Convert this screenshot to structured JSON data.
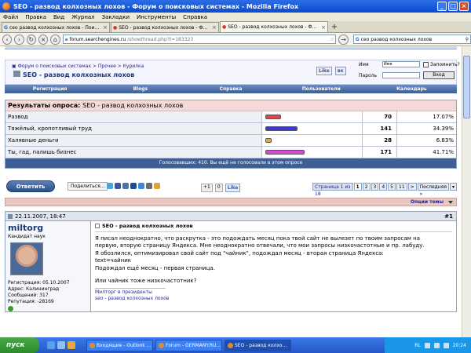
{
  "window": {
    "title": "SEO - развод колхозных лохов - Форум о поисковых системах - Mozilla Firefox"
  },
  "menu": [
    "Файл",
    "Правка",
    "Вид",
    "Журнал",
    "Закладки",
    "Инструменты",
    "Справка"
  ],
  "tabs": [
    {
      "label": "сео развод колхозных лохов - Поиск в..."
    },
    {
      "label": "SEO - развод колхозных лохов - Фору..."
    },
    {
      "label": "SEO - развод колхозных лохов - Фору..."
    }
  ],
  "address": {
    "domain": "forum.searchengines.ru",
    "path": "/showthread.php?t=183323"
  },
  "search": {
    "value": "сео развод колхозных лохов"
  },
  "forum": {
    "breadcrumb": [
      "Форум о поисковых системах",
      "Прочее",
      "Курилка"
    ],
    "thread_title": "SEO - развод колхозных лохов",
    "like_label": "Like",
    "login": {
      "name_label": "Имя",
      "name_value": "Имя",
      "password_label": "Пароль",
      "remember_label": "Запомнить?",
      "login_button": "Вход"
    },
    "nav": [
      "Регистрация",
      "Blogs",
      "Справка",
      "Пользователи",
      "Календарь"
    ]
  },
  "poll": {
    "title": "Результаты опроса:",
    "thread_name": "SEO - развод колхозных лохов",
    "options": [
      {
        "label": "Развод",
        "votes": "70",
        "percent": "17.07%",
        "fraction": 0.1707,
        "color": "#d9464b"
      },
      {
        "label": "Тяжёлый, кропотливый труд",
        "votes": "141",
        "percent": "34.39%",
        "fraction": 0.3439,
        "color": "#3a3ad0"
      },
      {
        "label": "Халявные деньги",
        "votes": "28",
        "percent": "6.83%",
        "fraction": 0.0683,
        "color": "#e8a83a"
      },
      {
        "label": "Ты, гад, палишь бизнес",
        "votes": "171",
        "percent": "41.71%",
        "fraction": 0.4171,
        "color": "#d64ad6"
      }
    ],
    "footer": "Голосовавших: 410. Вы ещё не голосовали в этом опросе"
  },
  "actions": {
    "reply": "Ответить",
    "share": "Поделиться...",
    "vote_count": "+1",
    "vote_zero": "0",
    "like": "Like",
    "pager_label": "Страница 1 из 18",
    "pages": [
      "1",
      "2",
      "3",
      "4",
      "5",
      "11"
    ],
    "next": ">",
    "last": "Последняя »",
    "tools": "Опции темы"
  },
  "post": {
    "date": "22.11.2007, 18:47",
    "number": "#1",
    "user": {
      "name": "miltorg",
      "rank": "Кандидат наук",
      "registered": "Регистрация: 05.10.2007",
      "address": "Адрес: Калининград",
      "messages": "Сообщений: 317",
      "reputation": "Репутация: -28169"
    },
    "title": "SEO - развод колхозных лохов",
    "lines": [
      "Я писал неоднократно, что раскрутка - это подождать месяц пока твой сайт не вылезет по твоим запросам на",
      "первую, вторую страницу Яндекса. Мне неоднократно отвечали, что мои запросы низкочастотные и пр. лабуду.",
      "Я обозлился, оптимизировал свой сайт под \"чайник\", подождал месяц - вторая страница Яндекса:",
      "text=чайник",
      "Подождал ещё месяц - первая страница."
    ],
    "question": "Или чайник тоже низкочастотник?",
    "signature": [
      "Милторг в президенты",
      "seo - развод колхозных лохов"
    ]
  },
  "taskbar": {
    "start": "пуск",
    "buttons": [
      "Входящие - Outlook ...",
      "Forum - GERMANY.RU...",
      "SEO - развод колхо..."
    ],
    "lang": "RL",
    "time": "20:24"
  }
}
